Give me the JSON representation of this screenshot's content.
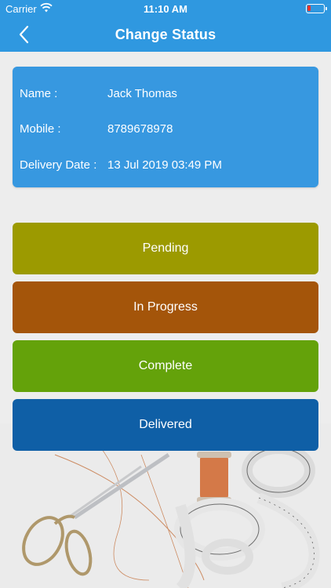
{
  "status_bar": {
    "carrier": "Carrier",
    "time": "11:10 AM",
    "battery_color": "#e8332b"
  },
  "nav": {
    "title": "Change Status",
    "back_icon": "chevron-left-icon"
  },
  "info": {
    "name_label": "Name :",
    "name_value": "Jack Thomas",
    "mobile_label": "Mobile :",
    "mobile_value": "8789678978",
    "delivery_label": "Delivery Date :",
    "delivery_value": "13 Jul 2019 03:49 PM"
  },
  "statuses": {
    "pending": "Pending",
    "in_progress": "In Progress",
    "complete": "Complete",
    "delivered": "Delivered"
  },
  "colors": {
    "brand": "#2f98e0",
    "card": "#3798e0",
    "pending": "#9c9a00",
    "in_progress": "#a4550a",
    "complete": "#64a20a",
    "delivered": "#0f5fa6"
  }
}
